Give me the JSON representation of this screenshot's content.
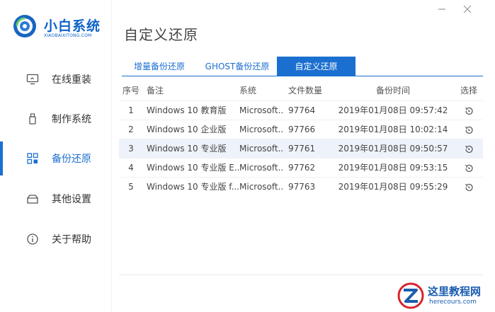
{
  "app": {
    "brand_name": "小白系统",
    "brand_sub": "XIAOBAIXITONG.COM"
  },
  "window": {
    "min_icon": "minimize-icon",
    "close_icon": "close-icon"
  },
  "sidebar": {
    "items": [
      {
        "label": "在线重装",
        "icon": "monitor-icon"
      },
      {
        "label": "制作系统",
        "icon": "usb-icon"
      },
      {
        "label": "备份还原",
        "icon": "backup-grid-icon",
        "active": true
      },
      {
        "label": "其他设置",
        "icon": "box-icon"
      },
      {
        "label": "关于帮助",
        "icon": "info-icon"
      }
    ]
  },
  "main": {
    "title": "自定义还原",
    "tabs": [
      {
        "label": "增量备份还原"
      },
      {
        "label": "GHOST备份还原"
      },
      {
        "label": "自定义还原",
        "active": true
      }
    ],
    "table": {
      "headers": [
        "序号",
        "备注",
        "系统",
        "文件数量",
        "备份时间",
        "选择"
      ],
      "rows": [
        {
          "index": "1",
          "note": "Windows 10 教育版",
          "system": "Microsoft...",
          "count": "97764",
          "time": "2019年01月08日 09:57:42"
        },
        {
          "index": "2",
          "note": "Windows 10 企业版",
          "system": "Microsoft...",
          "count": "97766",
          "time": "2019年01月08日 10:02:14"
        },
        {
          "index": "3",
          "note": "Windows 10 专业版",
          "system": "Microsoft...",
          "count": "97761",
          "time": "2019年01月08日 09:50:57"
        },
        {
          "index": "4",
          "note": "Windows 10 专业版 E...",
          "system": "Microsoft...",
          "count": "97762",
          "time": "2019年01月08日 09:53:15"
        },
        {
          "index": "5",
          "note": "Windows 10 专业版 f...",
          "system": "Microsoft...",
          "count": "97763",
          "time": "2019年01月08日 09:55:29"
        }
      ],
      "action_icon": "restore-icon"
    }
  },
  "watermark": {
    "text": "这里教程网",
    "sub": "herecours.com"
  },
  "colors": {
    "accent": "#1b6fd0",
    "brand": "#0c62c7",
    "row_highlight": "#eef3fb"
  }
}
